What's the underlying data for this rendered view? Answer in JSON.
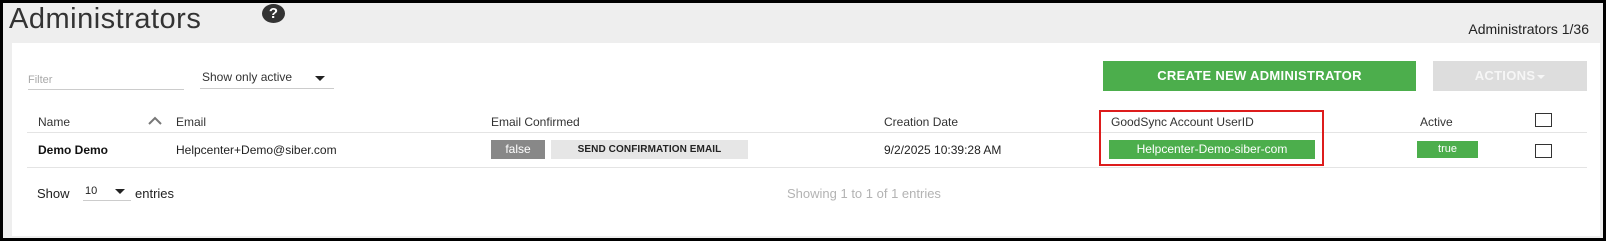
{
  "page": {
    "title": "Administrators",
    "help_icon": "question-circle-icon",
    "counter": "Administrators 1/36"
  },
  "toolbar": {
    "filter_placeholder": "Filter",
    "status_filter_value": "Show only active",
    "create_label": "CREATE NEW ADMINISTRATOR",
    "actions_label": "ACTIONS"
  },
  "table": {
    "columns": {
      "name": "Name",
      "email": "Email",
      "email_confirmed": "Email Confirmed",
      "creation_date": "Creation Date",
      "userid": "GoodSync Account UserID",
      "active": "Active"
    },
    "rows": [
      {
        "name": "Demo Demo",
        "email": "Helpcenter+Demo@siber.com",
        "email_confirmed": "false",
        "send_confirmation": "SEND CONFIRMATION EMAIL",
        "creation_date": "9/2/2025 10:39:28 AM",
        "userid": "Helpcenter-Demo-siber-com",
        "active": "true"
      }
    ]
  },
  "footer": {
    "show_label": "Show",
    "page_size": "10",
    "entries_label": "entries",
    "showing_text": "Showing 1 to 1 of 1 entries"
  },
  "colors": {
    "primary_green": "#4cae4c",
    "highlight_red": "#dd1c1c",
    "badge_grey": "#888888",
    "actions_disabled": "#dddddd"
  }
}
